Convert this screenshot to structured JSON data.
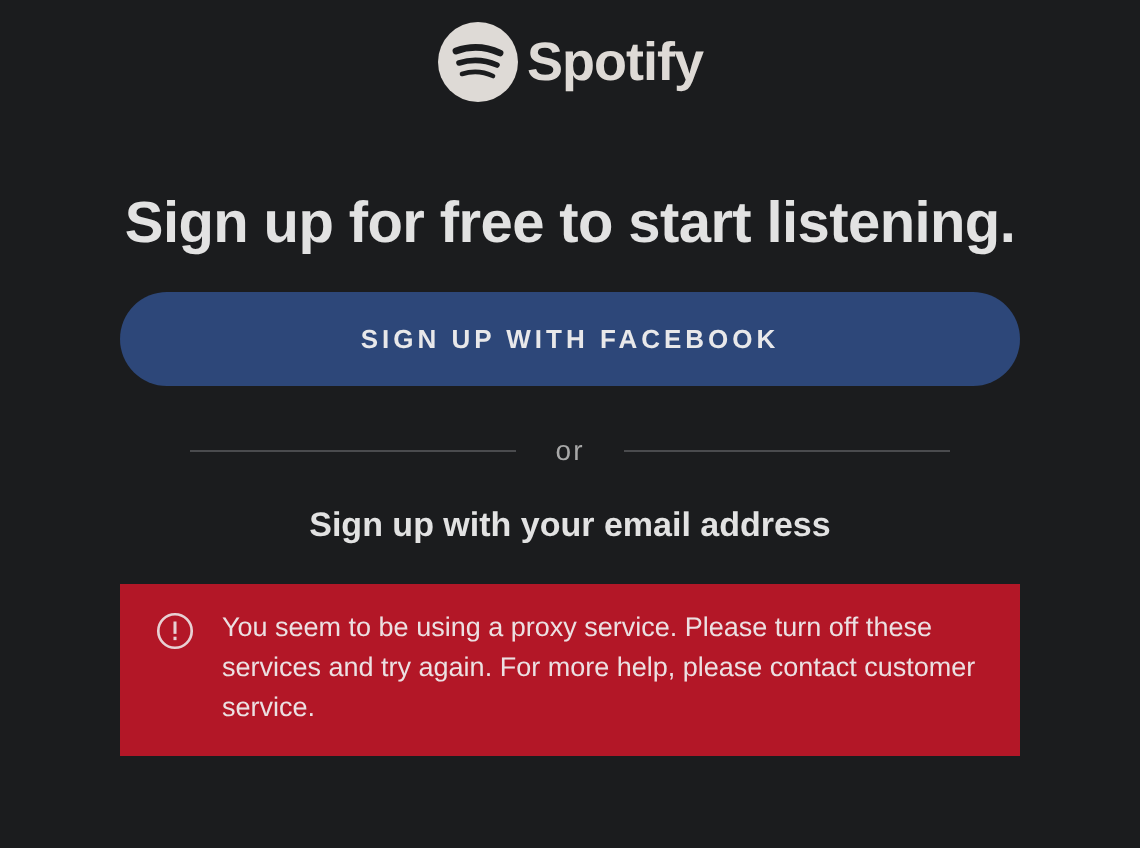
{
  "logo": {
    "wordmark": "Spotify"
  },
  "heading": "Sign up for free to start listening.",
  "facebook_button": {
    "label": "SIGN UP WITH FACEBOOK"
  },
  "divider": {
    "label": "or"
  },
  "email_heading": "Sign up with your email address",
  "error": {
    "message": "You seem to be using a proxy service. Please turn off these services and try again. For more help, please contact customer service."
  }
}
